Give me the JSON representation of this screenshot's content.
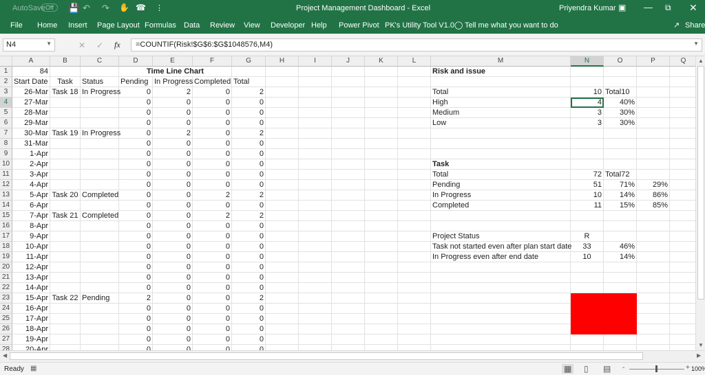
{
  "titlebar": {
    "autosave": "AutoSave",
    "autosave_state": "Off",
    "title": "Project Management Dashboard  -  Excel",
    "user": "Priyendra Kumar"
  },
  "ribbon": {
    "tabs": [
      "File",
      "Home",
      "Insert",
      "Page Layout",
      "Formulas",
      "Data",
      "Review",
      "View",
      "Developer",
      "Help",
      "Power Pivot",
      "PK's Utility Tool V1.0"
    ],
    "tell_me": "Tell me what you want to do",
    "share": "Share"
  },
  "formula_bar": {
    "name_box": "N4",
    "formula": "=COUNTIF(Risk!$G$6:$G$1048576,M4)"
  },
  "columns": [
    "A",
    "B",
    "C",
    "D",
    "E",
    "F",
    "G",
    "H",
    "I",
    "J",
    "K",
    "L",
    "M",
    "N",
    "O",
    "P",
    "Q"
  ],
  "selected": {
    "column": "N",
    "row": 4
  },
  "accent_color": "#217346",
  "status_fill_color": "#ff0000",
  "rows": [
    {
      "n": 1,
      "A": "84",
      "D": "Time Line Chart",
      "M": "Risk and issue"
    },
    {
      "n": 2,
      "A": "Start Date",
      "B": "Task",
      "C": "Status",
      "D": "Pending",
      "E": "In Progress",
      "F": "Completed",
      "G": "Total"
    },
    {
      "n": 3,
      "A": "26-Mar",
      "B": "Task 18",
      "C": "In Progress",
      "D": "0",
      "E": "2",
      "F": "0",
      "G": "2",
      "M": "Total",
      "N": "10",
      "O": "Total10"
    },
    {
      "n": 4,
      "A": "27-Mar",
      "D": "0",
      "E": "0",
      "F": "0",
      "G": "0",
      "M": "High",
      "N": "4",
      "O": "40%"
    },
    {
      "n": 5,
      "A": "28-Mar",
      "D": "0",
      "E": "0",
      "F": "0",
      "G": "0",
      "M": "Medium",
      "N": "3",
      "O": "30%"
    },
    {
      "n": 6,
      "A": "29-Mar",
      "D": "0",
      "E": "0",
      "F": "0",
      "G": "0",
      "M": "Low",
      "N": "3",
      "O": "30%"
    },
    {
      "n": 7,
      "A": "30-Mar",
      "B": "Task 19",
      "C": "In Progress",
      "D": "0",
      "E": "2",
      "F": "0",
      "G": "2"
    },
    {
      "n": 8,
      "A": "31-Mar",
      "D": "0",
      "E": "0",
      "F": "0",
      "G": "0"
    },
    {
      "n": 9,
      "A": "1-Apr",
      "D": "0",
      "E": "0",
      "F": "0",
      "G": "0"
    },
    {
      "n": 10,
      "A": "2-Apr",
      "D": "0",
      "E": "0",
      "F": "0",
      "G": "0",
      "M": "Task"
    },
    {
      "n": 11,
      "A": "3-Apr",
      "D": "0",
      "E": "0",
      "F": "0",
      "G": "0",
      "M": "Total",
      "N": "72",
      "O": "Total72"
    },
    {
      "n": 12,
      "A": "4-Apr",
      "D": "0",
      "E": "0",
      "F": "0",
      "G": "0",
      "M": "Pending",
      "N": "51",
      "O": "71%",
      "P": "29%"
    },
    {
      "n": 13,
      "A": "5-Apr",
      "B": "Task 20",
      "C": "Completed",
      "D": "0",
      "E": "0",
      "F": "2",
      "G": "2",
      "M": "In Progress",
      "N": "10",
      "O": "14%",
      "P": "86%"
    },
    {
      "n": 14,
      "A": "6-Apr",
      "D": "0",
      "E": "0",
      "F": "0",
      "G": "0",
      "M": "Completed",
      "N": "11",
      "O": "15%",
      "P": "85%"
    },
    {
      "n": 15,
      "A": "7-Apr",
      "B": "Task 21",
      "C": "Completed",
      "D": "0",
      "E": "0",
      "F": "2",
      "G": "2"
    },
    {
      "n": 16,
      "A": "8-Apr",
      "D": "0",
      "E": "0",
      "F": "0",
      "G": "0"
    },
    {
      "n": 17,
      "A": "9-Apr",
      "D": "0",
      "E": "0",
      "F": "0",
      "G": "0",
      "M": "Project Status",
      "N": "R"
    },
    {
      "n": 18,
      "A": "10-Apr",
      "D": "0",
      "E": "0",
      "F": "0",
      "G": "0",
      "M": "Task not started even after plan start date",
      "N": "33",
      "O": "46%"
    },
    {
      "n": 19,
      "A": "11-Apr",
      "D": "0",
      "E": "0",
      "F": "0",
      "G": "0",
      "M": "In Progress even after end date",
      "N": "10",
      "O": "14%"
    },
    {
      "n": 20,
      "A": "12-Apr",
      "D": "0",
      "E": "0",
      "F": "0",
      "G": "0"
    },
    {
      "n": 21,
      "A": "13-Apr",
      "D": "0",
      "E": "0",
      "F": "0",
      "G": "0"
    },
    {
      "n": 22,
      "A": "14-Apr",
      "D": "0",
      "E": "0",
      "F": "0",
      "G": "0"
    },
    {
      "n": 23,
      "A": "15-Apr",
      "B": "Task 22",
      "C": "Pending",
      "D": "2",
      "E": "0",
      "F": "0",
      "G": "2"
    },
    {
      "n": 24,
      "A": "16-Apr",
      "D": "0",
      "E": "0",
      "F": "0",
      "G": "0"
    },
    {
      "n": 25,
      "A": "17-Apr",
      "D": "0",
      "E": "0",
      "F": "0",
      "G": "0"
    },
    {
      "n": 26,
      "A": "18-Apr",
      "D": "0",
      "E": "0",
      "F": "0",
      "G": "0"
    },
    {
      "n": 27,
      "A": "19-Apr",
      "D": "0",
      "E": "0",
      "F": "0",
      "G": "0"
    },
    {
      "n": 28,
      "A": "20-Apr",
      "D": "0",
      "E": "0",
      "F": "0",
      "G": "0"
    }
  ],
  "status_bar": {
    "ready": "Ready",
    "zoom": "100%"
  }
}
